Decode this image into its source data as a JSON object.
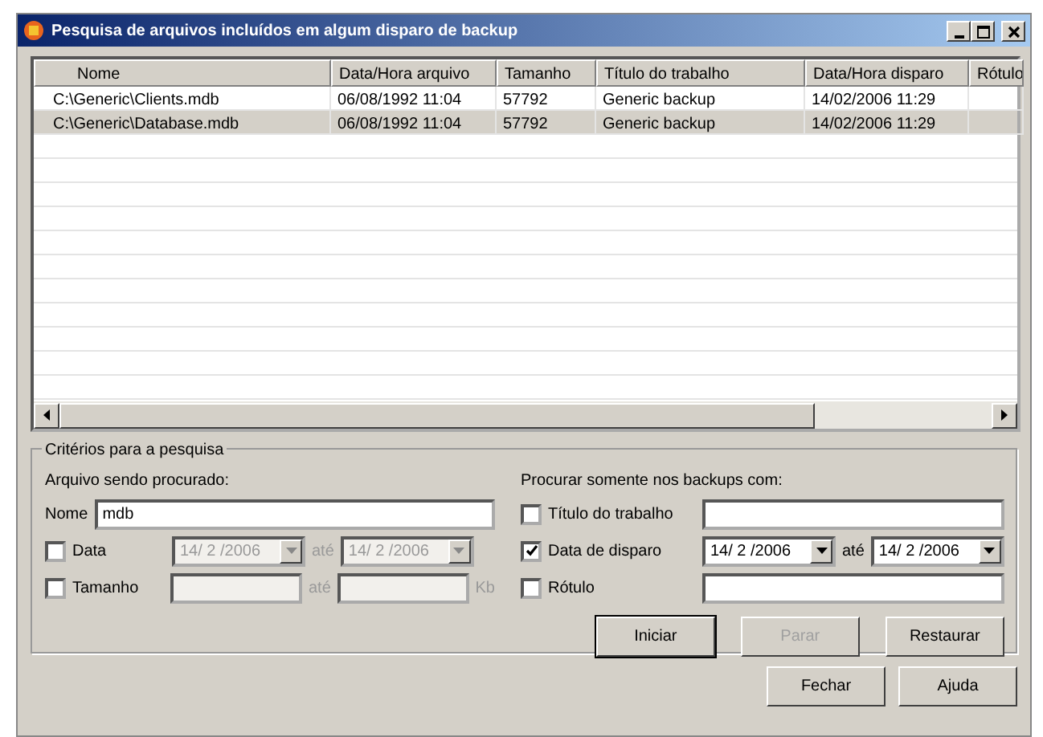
{
  "window": {
    "title": "Pesquisa de arquivos incluídos em algum disparo de backup"
  },
  "table": {
    "columns": [
      "Nome",
      "Data/Hora arquivo",
      "Tamanho",
      "Título do trabalho",
      "Data/Hora disparo",
      "Rótulo"
    ],
    "rows": [
      {
        "cells": [
          "C:\\Generic\\Clients.mdb",
          "06/08/1992 11:04",
          "57792",
          "Generic backup",
          "14/02/2006 11:29"
        ],
        "selected": false
      },
      {
        "cells": [
          "C:\\Generic\\Database.mdb",
          "06/08/1992 11:04",
          "57792",
          "Generic backup",
          "14/02/2006 11:29"
        ],
        "selected": true
      }
    ]
  },
  "criteria": {
    "title": "Critérios para a pesquisa",
    "file_section": {
      "title": "Arquivo sendo procurado:",
      "name_label": "Nome",
      "name_value": "mdb",
      "date": {
        "label": "Data",
        "checked": false,
        "from": "14/ 2 /2006",
        "sep": "até",
        "to": "14/ 2 /2006"
      },
      "size": {
        "label": "Tamanho",
        "checked": false,
        "sep": "até",
        "unit": "Kb"
      }
    },
    "backup_section": {
      "title": "Procurar somente nos backups com:",
      "job_title": {
        "label": "Título do trabalho",
        "checked": false
      },
      "date": {
        "label": "Data de disparo",
        "checked": true,
        "from": "14/ 2 /2006",
        "sep": "até",
        "to": "14/ 2 /2006"
      },
      "label": {
        "label": "Rótulo",
        "checked": false
      }
    },
    "buttons": [
      {
        "label": "Iniciar",
        "disabled": false,
        "default": true
      },
      {
        "label": "Parar",
        "disabled": true,
        "default": false
      },
      {
        "label": "Restaurar",
        "disabled": false,
        "default": false
      }
    ]
  },
  "buttons": [
    {
      "label": "Fechar"
    },
    {
      "label": "Ajuda"
    }
  ]
}
